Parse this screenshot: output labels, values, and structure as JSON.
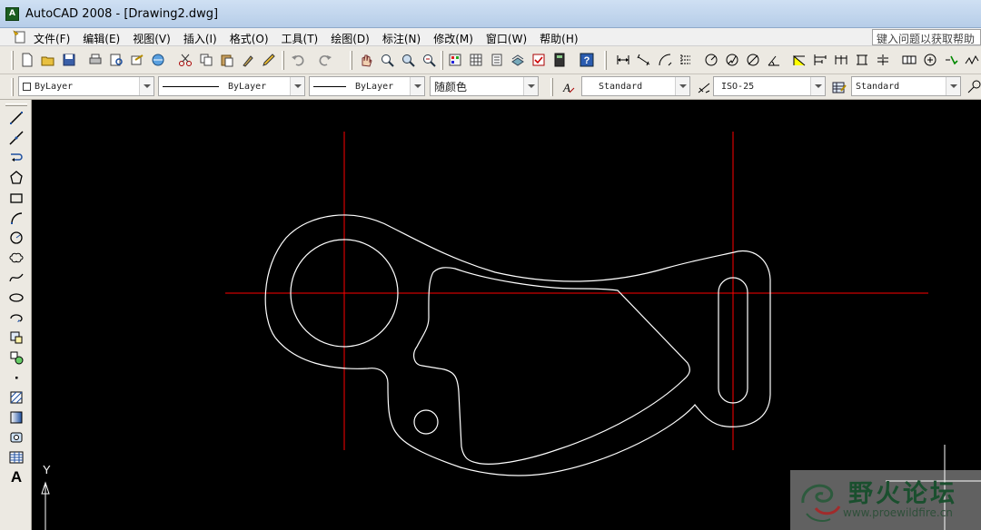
{
  "window": {
    "title": "AutoCAD 2008 - [Drawing2.dwg]"
  },
  "menubar": {
    "items": [
      "文件(F)",
      "编辑(E)",
      "视图(V)",
      "插入(I)",
      "格式(O)",
      "工具(T)",
      "绘图(D)",
      "标注(N)",
      "修改(M)",
      "窗口(W)",
      "帮助(H)"
    ],
    "help_search": "键入问题以获取帮助"
  },
  "properties_toolbar": {
    "layer": "ByLayer",
    "linetype": "ByLayer",
    "lineweight": "ByLayer",
    "color": "随颜色"
  },
  "styles_toolbar": {
    "text_style": "Standard",
    "dim_style": "ISO-25",
    "table_style": "Standard"
  },
  "ucs": {
    "y_label": "Y"
  },
  "left_toolbar": {
    "icons": [
      "line-icon",
      "construction-line-icon",
      "polyline-icon",
      "polygon-icon",
      "rectangle-icon",
      "arc-icon",
      "circle-icon",
      "revision-cloud-icon",
      "spline-icon",
      "ellipse-icon",
      "ellipse-arc-icon",
      "insert-block-icon",
      "make-block-icon",
      "point-icon",
      "hatch-icon",
      "gradient-icon",
      "region-icon",
      "table-icon",
      "multiline-text-icon"
    ],
    "text_tool": "A"
  },
  "watermark": {
    "title": "野火论坛",
    "url": "www.proewildfire.cn"
  },
  "colors": {
    "canvas": "#000000",
    "centerline": "#ff0000",
    "geometry": "#ffffff"
  }
}
